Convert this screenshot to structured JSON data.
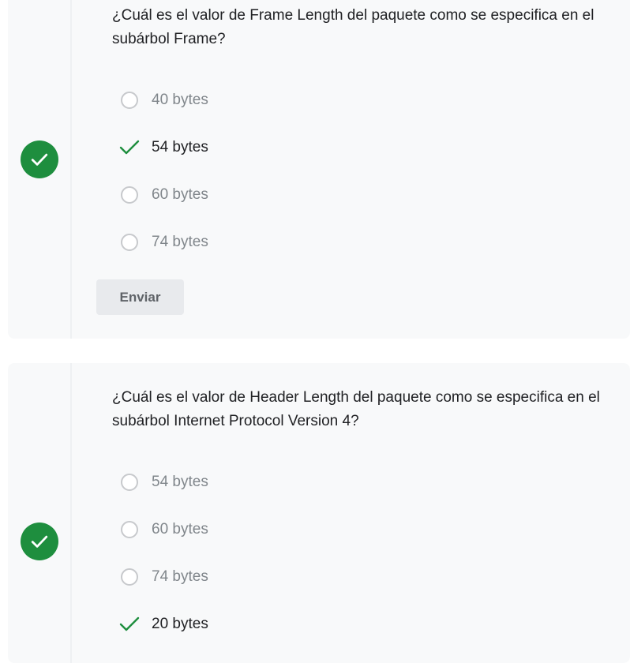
{
  "questions": [
    {
      "text": "¿Cuál es el valor de Frame Length del paquete como se especifica en el subárbol Frame?",
      "options": [
        {
          "label": "40 bytes",
          "selected": false
        },
        {
          "label": "54 bytes",
          "selected": true
        },
        {
          "label": "60 bytes",
          "selected": false
        },
        {
          "label": "74 bytes",
          "selected": false
        }
      ],
      "submit_label": "Enviar",
      "status": "correct"
    },
    {
      "text": "¿Cuál es el valor de Header Length del paquete como se especifica en el subárbol Internet Protocol Version 4?",
      "options": [
        {
          "label": "54 bytes",
          "selected": false
        },
        {
          "label": "60 bytes",
          "selected": false
        },
        {
          "label": "74 bytes",
          "selected": false
        },
        {
          "label": "20 bytes",
          "selected": true
        }
      ],
      "status": "correct"
    }
  ],
  "colors": {
    "correct": "#1e8e3e",
    "card_bg": "#f8f9fa",
    "unselected_text": "#80868b",
    "radio_border": "#c7c9cc"
  },
  "icons": {
    "status": "check-circle-icon",
    "selected_mark": "check-icon"
  }
}
